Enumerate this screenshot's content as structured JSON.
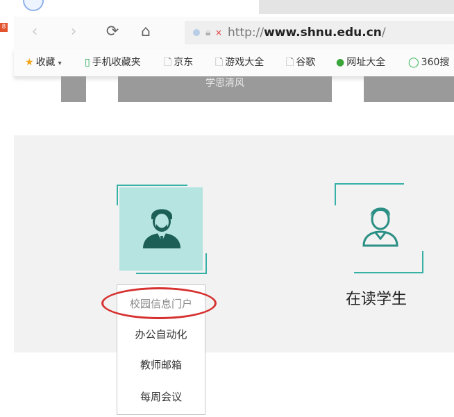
{
  "browser": {
    "url_prefix": "http://",
    "url_domain": "www.shnu.edu.cn",
    "url_suffix": "/",
    "side_marker": "8"
  },
  "bookmarks": [
    {
      "icon": "star-icon",
      "label": "收藏"
    },
    {
      "icon": "phone-icon",
      "label": "手机收藏夹"
    },
    {
      "icon": "document-icon",
      "label": "京东"
    },
    {
      "icon": "document-icon",
      "label": "游戏大全"
    },
    {
      "icon": "document-icon",
      "label": "谷歌"
    },
    {
      "icon": "globe-icon",
      "label": "网址大全"
    },
    {
      "icon": "ring-icon",
      "label": "360搜"
    }
  ],
  "page": {
    "banner_text": "学思清风",
    "roles": [
      {
        "label": "在读学生"
      }
    ],
    "dropdown": [
      {
        "label": "校园信息门户",
        "state": "hover"
      },
      {
        "label": "办公自动化"
      },
      {
        "label": "教师邮箱"
      },
      {
        "label": "每周会议"
      }
    ]
  },
  "colors": {
    "accent_teal": "#37b0a6",
    "teal_fill": "#b6e4e1",
    "annotation_red": "#d6302f"
  }
}
